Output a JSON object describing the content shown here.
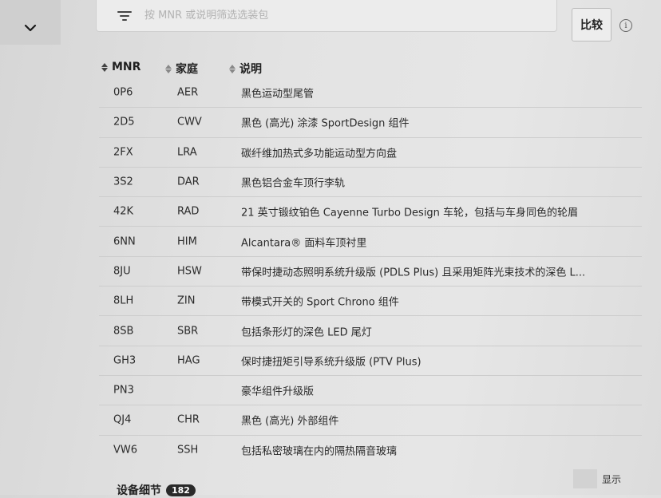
{
  "search": {
    "placeholder": "按 MNR 或说明筛选选装包"
  },
  "toolbar": {
    "compare_label": "比较",
    "info_glyph": "i"
  },
  "table": {
    "columns": [
      {
        "label": "MNR"
      },
      {
        "label": "家庭"
      },
      {
        "label": "说明"
      }
    ],
    "rows": [
      {
        "mnr": "0P6",
        "family": "AER",
        "desc": "黑色运动型尾管"
      },
      {
        "mnr": "2D5",
        "family": "CWV",
        "desc": "黑色 (高光) 涂漆 SportDesign 组件"
      },
      {
        "mnr": "2FX",
        "family": "LRA",
        "desc": "碳纤维加热式多功能运动型方向盘"
      },
      {
        "mnr": "3S2",
        "family": "DAR",
        "desc": "黑色铝合金车顶行李轨"
      },
      {
        "mnr": "42K",
        "family": "RAD",
        "desc": "21 英寸锻纹铂色 Cayenne Turbo Design 车轮，包括与车身同色的轮眉"
      },
      {
        "mnr": "6NN",
        "family": "HIM",
        "desc": "Alcantara® 面料车顶衬里"
      },
      {
        "mnr": "8JU",
        "family": "HSW",
        "desc": "带保时捷动态照明系统升级版 (PDLS Plus) 且采用矩阵光束技术的深色 L..."
      },
      {
        "mnr": "8LH",
        "family": "ZIN",
        "desc": "带模式开关的 Sport Chrono 组件"
      },
      {
        "mnr": "8SB",
        "family": "SBR",
        "desc": "包括条形灯的深色 LED 尾灯"
      },
      {
        "mnr": "GH3",
        "family": "HAG",
        "desc": "保时捷扭矩引导系统升级版 (PTV Plus)"
      },
      {
        "mnr": "PN3",
        "family": "",
        "desc": "豪华组件升级版"
      },
      {
        "mnr": "QJ4",
        "family": "CHR",
        "desc": "黑色 (高光) 外部组件"
      },
      {
        "mnr": "VW6",
        "family": "SSH",
        "desc": "包括私密玻璃在内的隔热隔音玻璃"
      }
    ]
  },
  "footer": {
    "section_label": "设备细节",
    "count": "182",
    "show_label": "显示"
  },
  "icons": {
    "collapse": "chevron-down-icon",
    "filter": "filter-icon",
    "sort": "sort-icon",
    "info": "info-icon"
  }
}
